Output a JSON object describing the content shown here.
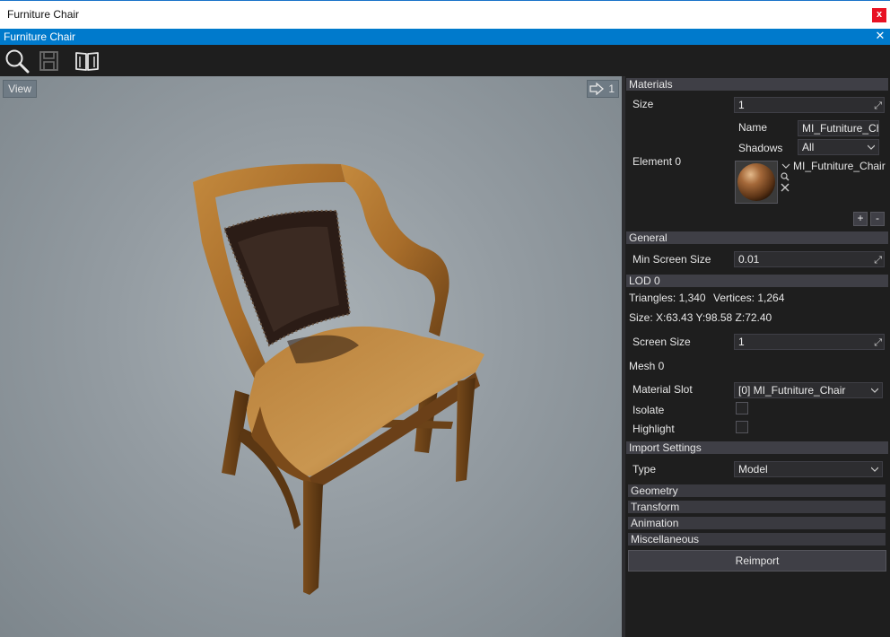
{
  "os_window": {
    "title": "Furniture Chair",
    "close_glyph": "x"
  },
  "tab": {
    "title": "Furniture Chair",
    "close_glyph": "✕"
  },
  "toolbar": {
    "buttons": [
      {
        "icon": "search-icon"
      },
      {
        "icon": "save-icon"
      },
      {
        "icon": "book-icon"
      }
    ]
  },
  "viewport": {
    "view_label": "View",
    "camera_speed": "1"
  },
  "properties": {
    "materials": {
      "header": "Materials",
      "size_label": "Size",
      "size_value": "1",
      "element_label": "Element 0",
      "name_label": "Name",
      "name_value": "MI_Futniture_Chair",
      "shadows_label": "Shadows",
      "shadows_value": "All",
      "asset_name": "MI_Futniture_Chair",
      "add_label": "+",
      "remove_label": "-"
    },
    "general": {
      "header": "General",
      "min_screen_size_label": "Min Screen Size",
      "min_screen_size_value": "0.01"
    },
    "lod0": {
      "header": "LOD 0",
      "triangles_text": "Triangles: 1,340",
      "vertices_text": "Vertices: 1,264",
      "size_text": "Size: X:63.43 Y:98.58 Z:72.40",
      "screen_size_label": "Screen Size",
      "screen_size_value": "1",
      "mesh_label": "Mesh 0",
      "material_slot_label": "Material Slot",
      "material_slot_value": "[0] MI_Futniture_Chair",
      "isolate_label": "Isolate",
      "highlight_label": "Highlight"
    },
    "import_settings": {
      "header": "Import Settings",
      "type_label": "Type",
      "type_value": "Model",
      "sub_sections": [
        "Geometry",
        "Transform",
        "Animation",
        "Miscellaneous"
      ],
      "reimport_label": "Reimport"
    }
  },
  "colors": {
    "accent": "#007acc",
    "panel_bg": "#1e1e1e",
    "header_bg": "#3f3f46",
    "close_red": "#e81123"
  }
}
